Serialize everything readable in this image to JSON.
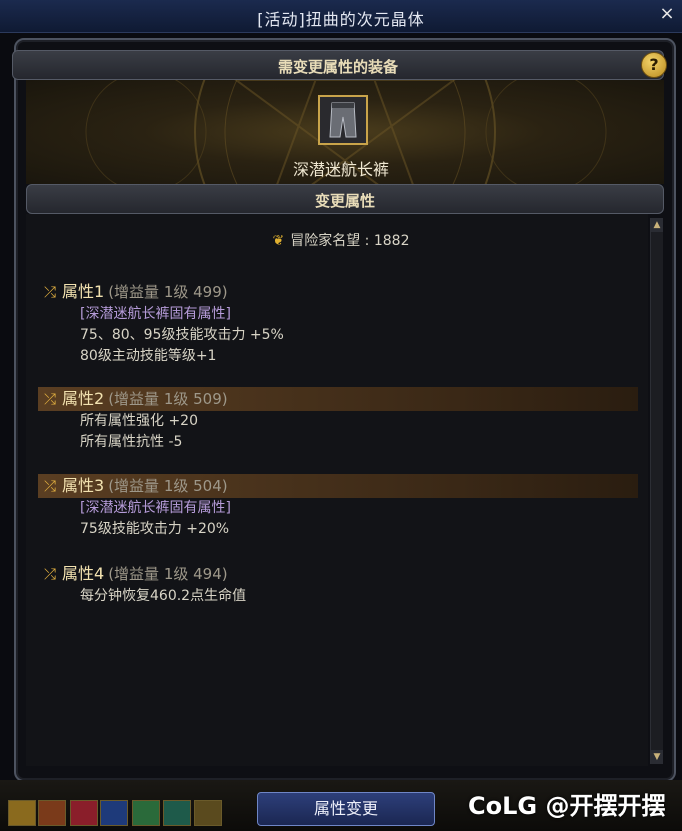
{
  "window": {
    "title": "[活动]扭曲的次元晶体",
    "close_symbol": "×"
  },
  "equipment_section": {
    "label": "需变更属性的装备",
    "help_symbol": "?",
    "item_name": "深潜迷航长裤"
  },
  "change_section": {
    "label": "变更属性"
  },
  "reputation": {
    "label": "冒险家名望 : 1882"
  },
  "attributes": [
    {
      "name": "属性1",
      "meta": "(增益量 1级 499)",
      "highlighted": false,
      "lines": [
        {
          "text": "[深潜迷航长裤固有属性]",
          "unique": true
        },
        {
          "text": "75、80、95级技能攻击力 +5%",
          "unique": false
        },
        {
          "text": "80级主动技能等级+1",
          "unique": false
        }
      ]
    },
    {
      "name": "属性2",
      "meta": "(增益量 1级 509)",
      "highlighted": true,
      "lines": [
        {
          "text": "所有属性强化 +20",
          "unique": false
        },
        {
          "text": "所有属性抗性 -5",
          "unique": false
        }
      ]
    },
    {
      "name": "属性3",
      "meta": "(增益量 1级 504)",
      "highlighted": true,
      "lines": [
        {
          "text": "[深潜迷航长裤固有属性]",
          "unique": true
        },
        {
          "text": "75级技能攻击力 +20%",
          "unique": false
        }
      ]
    },
    {
      "name": "属性4",
      "meta": "(增益量 1级 494)",
      "highlighted": false,
      "lines": [
        {
          "text": "每分钟恢复460.2点生命值",
          "unique": false
        }
      ]
    }
  ],
  "actions": {
    "change_button": "属性变更"
  },
  "watermark": {
    "text": "CoLG @开摆开摆"
  },
  "colors": {
    "accent_gold": "#e2b040",
    "unique_purple": "#b59bd8",
    "highlight_row": "#5a3e22"
  }
}
